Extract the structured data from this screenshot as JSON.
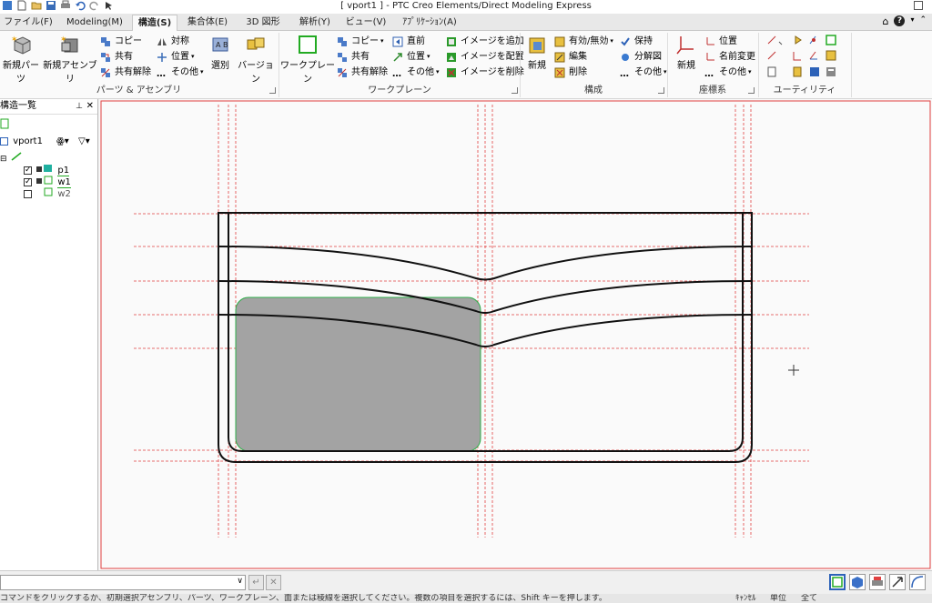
{
  "window": {
    "title": "[ vport1 ] - PTC Creo Elements/Direct Modeling Express"
  },
  "tabs": [
    {
      "label": "ファイル(F)",
      "active": false
    },
    {
      "label": "Modeling(M)",
      "active": false
    },
    {
      "label": "構造(S)",
      "active": true
    },
    {
      "label": "集合体(E)",
      "active": false
    },
    {
      "label": "3D 図形",
      "active": false
    },
    {
      "label": "解析(Y)",
      "active": false
    },
    {
      "label": "ビュー(V)",
      "active": false
    },
    {
      "label": "ｱﾌﾟﾘｹｰｼｮﾝ(A)",
      "active": false
    }
  ],
  "ribbon": {
    "parts": {
      "group_label": "パーツ & アセンブリ",
      "new_part": "新規パーツ",
      "new_assembly": "新規アセンブリ",
      "copy": "コピー",
      "share": "共有",
      "unshare": "共有解除",
      "mirror": "対称",
      "position": "位置",
      "other": "その他",
      "select": "選別",
      "version": "バージョン"
    },
    "workplane": {
      "group_label": "ワークプレーン",
      "workplane": "ワークプレーン",
      "copy": "コピー",
      "share": "共有",
      "unshare": "共有解除",
      "front": "直前",
      "position": "位置",
      "other": "その他",
      "add_image": "イメージを追加",
      "place_image": "イメージを配置",
      "delete_image": "イメージを削除"
    },
    "config": {
      "group_label": "構成",
      "new": "新規",
      "enable_disable": "有効/無効",
      "edit": "編集",
      "delete": "削除",
      "keep": "保持",
      "explode": "分解図",
      "other": "その他"
    },
    "coord": {
      "group_label": "座標系",
      "new": "新規",
      "position": "位置",
      "rename": "名前変更",
      "other": "その他"
    },
    "utility": {
      "group_label": "ユーティリティ"
    }
  },
  "panel": {
    "title": "構造一覧",
    "root": "vport1",
    "items": [
      {
        "name": "p1",
        "checked": true
      },
      {
        "name": "w1",
        "checked": true
      },
      {
        "name": "w2",
        "checked": false
      }
    ]
  },
  "statusbar": {
    "message": "コマンドをクリックするか、初期選択アセンブリ、パーツ、ワークプレーン、面または稜線を選択してください。複数の項目を選択するには、Shift キーを押します。",
    "units": "単位",
    "all": "全て",
    "extra": "ｷｬﾝｾﾙ"
  },
  "colors": {
    "accent": "#2b579a",
    "construction_line": "#e04040",
    "part_fill": "#a3a3a3",
    "part_edge": "#2fae4a",
    "workplane_green": "#22aa22"
  }
}
